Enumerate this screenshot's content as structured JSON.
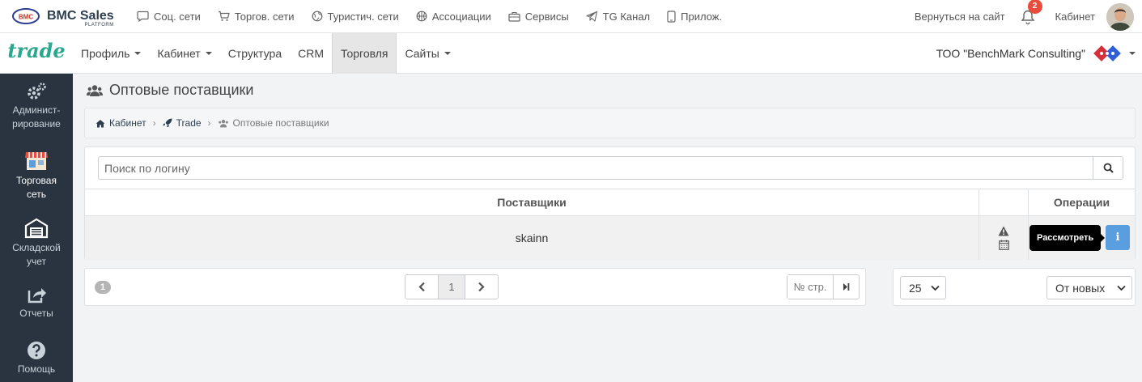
{
  "brand": {
    "name": "BMC Sales",
    "sub": "PLATFORM",
    "logo_text": "BMC"
  },
  "top_links": [
    {
      "label": "Соц. сети",
      "icon": "chat-icon"
    },
    {
      "label": "Торгов. сети",
      "icon": "cart-icon"
    },
    {
      "label": "Туристич. сети",
      "icon": "globe-icon"
    },
    {
      "label": "Ассоциации",
      "icon": "basketball-icon"
    },
    {
      "label": "Сервисы",
      "icon": "briefcase-icon"
    },
    {
      "label": "TG Канал",
      "icon": "telegram-icon"
    },
    {
      "label": "Прилож.",
      "icon": "phone-icon"
    }
  ],
  "top_right": {
    "back": "Вернуться на сайт",
    "notifications": "2",
    "cabinet": "Кабинет"
  },
  "nav": {
    "logo": "trade",
    "items": [
      {
        "label": "Профиль",
        "dropdown": true
      },
      {
        "label": "Кабинет",
        "dropdown": true
      },
      {
        "label": "Структура",
        "dropdown": false
      },
      {
        "label": "CRM",
        "dropdown": false
      },
      {
        "label": "Торговля",
        "dropdown": false,
        "active": true
      },
      {
        "label": "Сайты",
        "dropdown": true
      }
    ],
    "company": "ТОО \"BenchMark Consulting\""
  },
  "sidebar": [
    {
      "label": "Админист-\nрирование",
      "icon": "gears-icon"
    },
    {
      "label": "Торговая\nсеть",
      "icon": "store-icon",
      "active": true
    },
    {
      "label": "Складской\nучет",
      "icon": "warehouse-icon"
    },
    {
      "label": "Отчеты",
      "icon": "share-icon"
    },
    {
      "label": "Помощь",
      "icon": "help-icon"
    }
  ],
  "page_title": "Оптовые поставщики",
  "breadcrumb": {
    "home": "Кабинет",
    "trade": "Trade",
    "current": "Оптовые поставщики"
  },
  "search": {
    "placeholder": "Поиск по логину"
  },
  "table": {
    "headers": {
      "suppliers": "Поставщики",
      "operations": "Операции"
    },
    "rows": [
      {
        "supplier": "skainn"
      }
    ],
    "tooltip": "Рассмотреть",
    "info_label": "i"
  },
  "pager": {
    "total": "1",
    "current_page": "1",
    "goto_placeholder": "№ стр."
  },
  "options": {
    "per_page": "25",
    "sort": "От новых"
  },
  "colors": {
    "accent": "#5b9ee0",
    "sidebar": "#2a3440",
    "brand_green": "#2aa78e",
    "badge": "#e74c3c"
  }
}
